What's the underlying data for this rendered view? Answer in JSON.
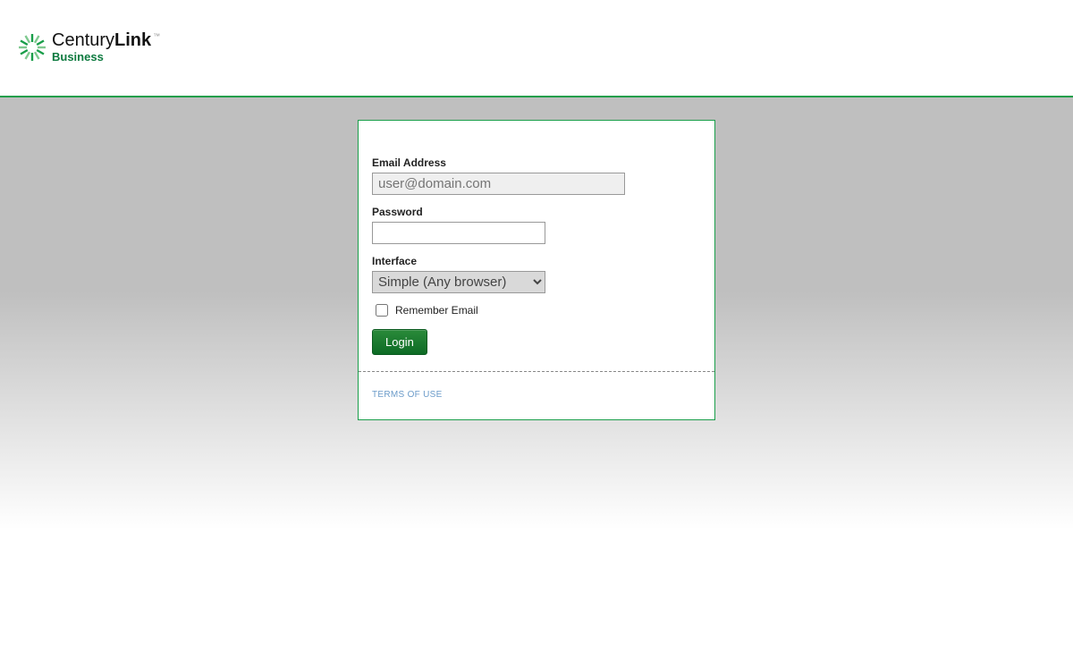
{
  "logo": {
    "part1": "Century",
    "part2": "Link",
    "tm": "™",
    "sub": "Business"
  },
  "form": {
    "email": {
      "label": "Email Address",
      "placeholder": "user@domain.com",
      "value": ""
    },
    "password": {
      "label": "Password",
      "value": ""
    },
    "interface": {
      "label": "Interface",
      "selected": "Simple (Any browser)"
    },
    "remember": {
      "label": "Remember Email"
    },
    "submit": {
      "label": "Login"
    }
  },
  "footer": {
    "terms": "TERMS OF USE"
  }
}
